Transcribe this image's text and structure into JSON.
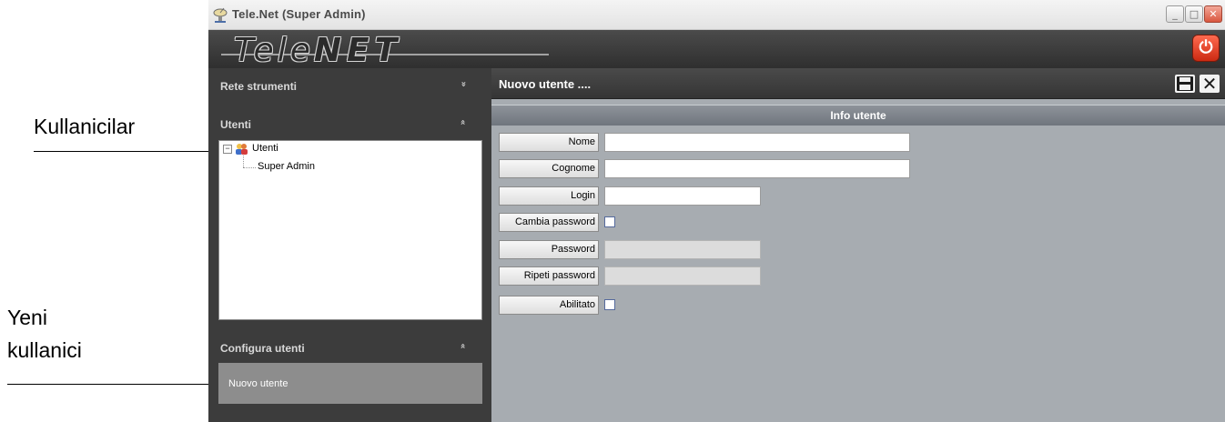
{
  "annotations": {
    "users_label": "Kullanicilar",
    "new_user_line1": "Yeni",
    "new_user_line2": "kullanici"
  },
  "window": {
    "title": "Tele.Net (Super Admin)",
    "controls": {
      "minimize": "_",
      "maximize": "□",
      "close": "✕"
    }
  },
  "banner": {
    "logo_light": "Tele",
    "logo_bold": "NET",
    "power_icon": "⏻"
  },
  "sidebar": {
    "sections": [
      {
        "label": "Rete strumenti",
        "chevron": "»"
      },
      {
        "label": "Utenti",
        "chevron": "»"
      },
      {
        "label": "Configura utenti",
        "chevron": "»"
      }
    ],
    "tree": {
      "root": "Utenti",
      "children": [
        "Super Admin"
      ]
    },
    "new_user_item": "Nuovo utente"
  },
  "main": {
    "title": "Nuovo utente ....",
    "section_title": "Info utente",
    "fields": [
      {
        "label": "Nome",
        "type": "text",
        "value": ""
      },
      {
        "label": "Cognome",
        "type": "text",
        "value": ""
      },
      {
        "label": "Login",
        "type": "text",
        "value": ""
      },
      {
        "label": "Cambia password",
        "type": "checkbox",
        "checked": false
      },
      {
        "label": "Password",
        "type": "text",
        "value": "",
        "disabled": true
      },
      {
        "label": "Ripeti password",
        "type": "text",
        "value": "",
        "disabled": true
      },
      {
        "label": "Abilitato",
        "type": "checkbox",
        "checked": false
      }
    ]
  },
  "colors": {
    "accent_power": "#e03a1f",
    "main_background": "#a7acb1",
    "sidebar_background": "#3c3c3c"
  }
}
